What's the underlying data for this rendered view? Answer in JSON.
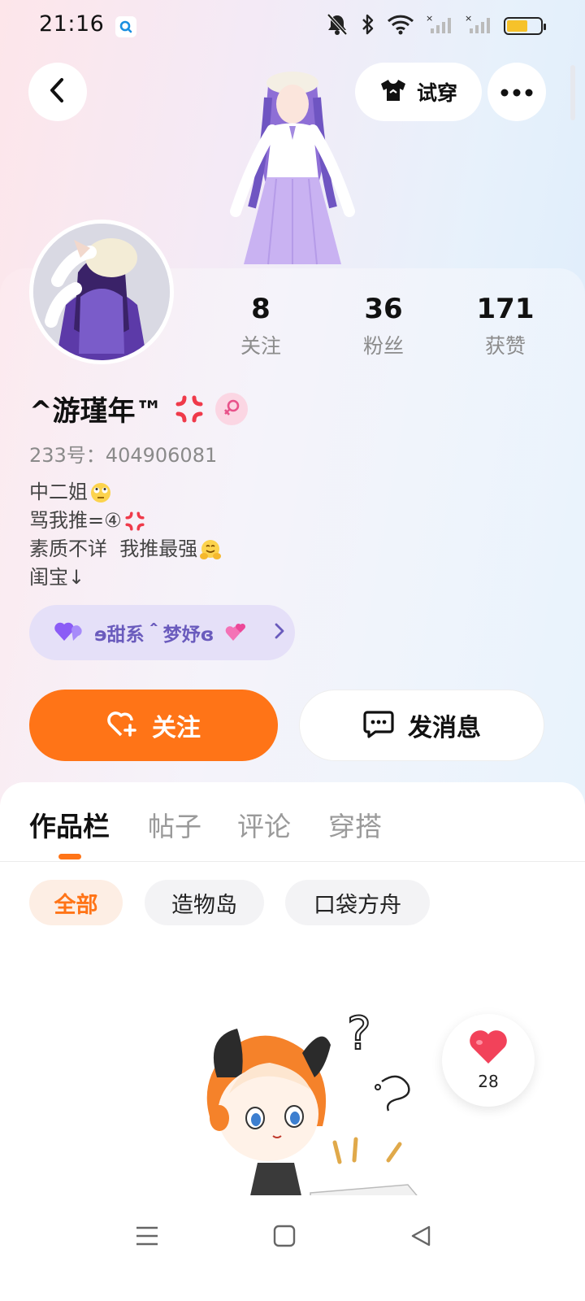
{
  "status_bar": {
    "time": "21:16"
  },
  "top_nav": {
    "tryon_label": "试穿"
  },
  "profile": {
    "stats": [
      {
        "value": "8",
        "label": "关注"
      },
      {
        "value": "36",
        "label": "粉丝"
      },
      {
        "value": "171",
        "label": "获赞"
      }
    ],
    "name": "^游瑾年™",
    "user_id": "233号：404906081",
    "bio": {
      "line1": "中二姐",
      "line2": "骂我推=④",
      "line3": "素质不详  我推最强",
      "line4": "闺宝↓"
    },
    "group_chip_label": "ɘ甜系＾梦妤ɞ"
  },
  "actions": {
    "follow_label": "关注",
    "message_label": "发消息"
  },
  "tabs": [
    "作品栏",
    "帖子",
    "评论",
    "穿搭"
  ],
  "filters": [
    "全部",
    "造物岛",
    "口袋方舟"
  ],
  "like_count": "28",
  "colors": {
    "accent": "#ff7417",
    "group_chip_bg": "#e5e0f8",
    "group_chip_text": "#6a5bbd",
    "heart": "#f2425a"
  },
  "icons": {
    "back": "chevron-left-icon",
    "tryon": "tshirt-icon",
    "more": "more-horizontal-icon",
    "gender": "female-icon",
    "follow": "heart-plus-icon",
    "message": "chat-bubble-icon",
    "like": "heart-icon"
  }
}
